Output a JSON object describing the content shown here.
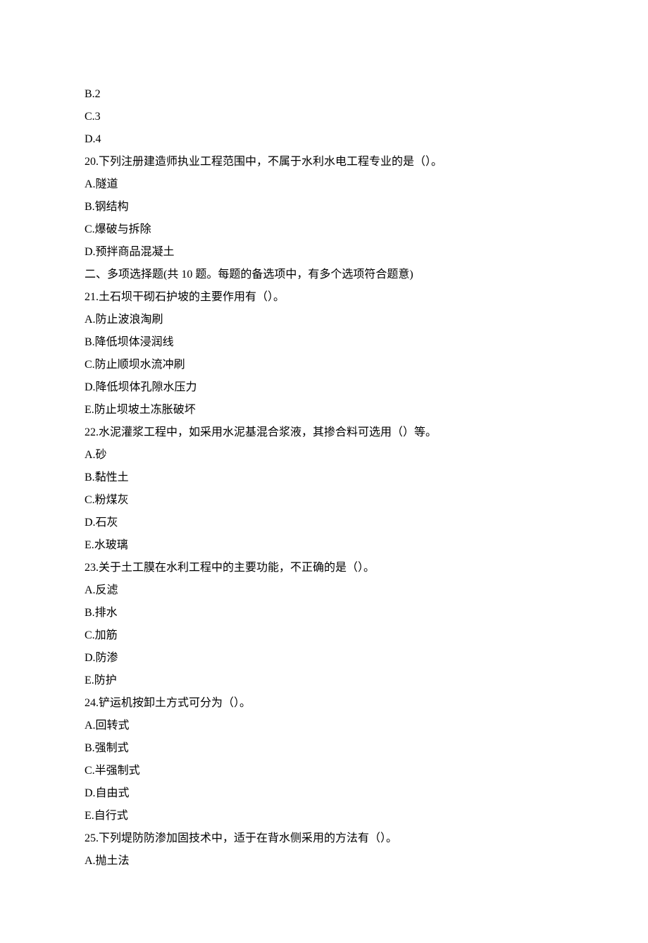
{
  "lines": {
    "l1": "B.2",
    "l2": "C.3",
    "l3": "D.4",
    "l4": "20.下列注册建造师执业工程范围中，不属于水利水电工程专业的是（）。",
    "l5": "A.隧道",
    "l6": "B.钢结构",
    "l7": "C.爆破与拆除",
    "l8": "D.预拌商品混凝土",
    "l9": "二、多项选择题(共 10 题。每题的备选项中，有多个选项符合题意)",
    "l10": "21.土石坝干砌石护坡的主要作用有（）。",
    "l11": "A.防止波浪淘刷",
    "l12": "B.降低坝体浸润线",
    "l13": "C.防止顺坝水流冲刷",
    "l14": "D.降低坝体孔隙水压力",
    "l15": "E.防止坝坡土冻胀破坏",
    "l16": "22.水泥灌浆工程中，如采用水泥基混合浆液，其掺合料可选用（）等。",
    "l17": "A.砂",
    "l18": "B.黏性土",
    "l19": "C.粉煤灰",
    "l20": "D.石灰",
    "l21": "E.水玻璃",
    "l22": "23.关于土工膜在水利工程中的主要功能，不正确的是（）。",
    "l23": "A.反滤",
    "l24": "B.排水",
    "l25": "C.加筋",
    "l26": "D.防渗",
    "l27": "E.防护",
    "l28": "24.铲运机按卸土方式可分为（）。",
    "l29": "A.回转式",
    "l30": "B.强制式",
    "l31": "C.半强制式",
    "l32": "D.自由式",
    "l33": "E.自行式",
    "l34": "25.下列堤防防渗加固技术中，适于在背水侧采用的方法有（）。",
    "l35": "A.抛土法"
  }
}
